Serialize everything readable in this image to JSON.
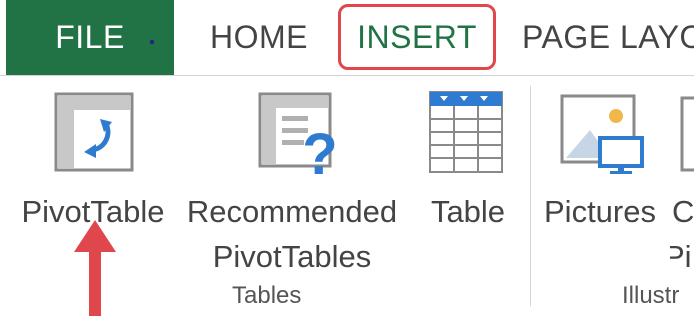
{
  "tabs": {
    "file": "FILE",
    "home": "HOME",
    "insert": "INSERT",
    "page_layout": "PAGE LAYO"
  },
  "ribbon": {
    "commands": {
      "pivottable": "PivotTable",
      "recommended_line1": "Recommended",
      "recommended_line2": "PivotTables",
      "table": "Table",
      "pictures": "Pictures",
      "partial_c": "C",
      "partial_pi": "Pi"
    },
    "groups": {
      "tables": "Tables",
      "illustrations": "Illustr"
    }
  },
  "colors": {
    "file_tab_bg": "#217346",
    "insert_text": "#217346",
    "highlight_border": "#e0474c",
    "arrow": "#e0474c",
    "icon_blue": "#2e7bcf"
  },
  "icons": {
    "pivottable": "pivottable-icon",
    "recommended": "recommended-pivottables-icon",
    "table": "table-icon",
    "pictures": "pictures-icon",
    "arrow": "up-arrow-annotation"
  }
}
